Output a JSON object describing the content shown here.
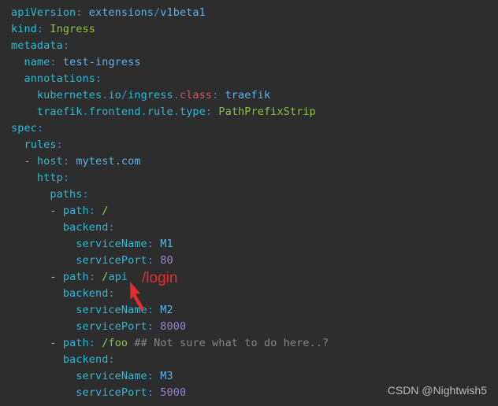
{
  "editor": {
    "background": "#2d2d2d",
    "language": "yaml",
    "filename_hint": "ingress.yaml",
    "lines": [
      {
        "indent": 0,
        "tokens": [
          {
            "text": "apiVersion",
            "type": "key"
          },
          {
            "text": ":",
            "type": "colon"
          },
          {
            "text": " ",
            "type": "plain"
          },
          {
            "text": "extensions",
            "type": "str"
          },
          {
            "text": "/",
            "type": "slash"
          },
          {
            "text": "v1beta1",
            "type": "str"
          }
        ]
      },
      {
        "indent": 0,
        "tokens": [
          {
            "text": "kind",
            "type": "key"
          },
          {
            "text": ":",
            "type": "colon"
          },
          {
            "text": " ",
            "type": "plain"
          },
          {
            "text": "Ingress",
            "type": "green"
          }
        ]
      },
      {
        "indent": 0,
        "tokens": [
          {
            "text": "metadata",
            "type": "key"
          },
          {
            "text": ":",
            "type": "colon"
          }
        ]
      },
      {
        "indent": 1,
        "tokens": [
          {
            "text": "name",
            "type": "key"
          },
          {
            "text": ":",
            "type": "colon"
          },
          {
            "text": " ",
            "type": "plain"
          },
          {
            "text": "test-ingress",
            "type": "str"
          }
        ]
      },
      {
        "indent": 1,
        "tokens": [
          {
            "text": "annotations",
            "type": "key"
          },
          {
            "text": ":",
            "type": "colon"
          }
        ]
      },
      {
        "indent": 2,
        "tokens": [
          {
            "text": "kubernetes",
            "type": "key"
          },
          {
            "text": ".",
            "type": "colon"
          },
          {
            "text": "io",
            "type": "key"
          },
          {
            "text": "/",
            "type": "slash"
          },
          {
            "text": "ingress",
            "type": "key"
          },
          {
            "text": ".",
            "type": "colon"
          },
          {
            "text": "class",
            "type": "kw"
          },
          {
            "text": ":",
            "type": "colon"
          },
          {
            "text": " ",
            "type": "plain"
          },
          {
            "text": "traefik",
            "type": "str"
          }
        ]
      },
      {
        "indent": 2,
        "tokens": [
          {
            "text": "traefik",
            "type": "key"
          },
          {
            "text": ".",
            "type": "colon"
          },
          {
            "text": "frontend",
            "type": "key"
          },
          {
            "text": ".",
            "type": "colon"
          },
          {
            "text": "rule",
            "type": "key"
          },
          {
            "text": ".",
            "type": "colon"
          },
          {
            "text": "type",
            "type": "key"
          },
          {
            "text": ":",
            "type": "colon"
          },
          {
            "text": " ",
            "type": "plain"
          },
          {
            "text": "PathPrefixStrip",
            "type": "green"
          }
        ]
      },
      {
        "indent": 0,
        "tokens": [
          {
            "text": "spec",
            "type": "key"
          },
          {
            "text": ":",
            "type": "colon"
          }
        ]
      },
      {
        "indent": 1,
        "tokens": [
          {
            "text": "rules",
            "type": "key"
          },
          {
            "text": ":",
            "type": "colon"
          }
        ]
      },
      {
        "indent": 1,
        "tokens": [
          {
            "text": "- ",
            "type": "dash"
          },
          {
            "text": "host",
            "type": "key"
          },
          {
            "text": ":",
            "type": "colon"
          },
          {
            "text": " ",
            "type": "plain"
          },
          {
            "text": "mytest.com",
            "type": "str"
          }
        ]
      },
      {
        "indent": 2,
        "tokens": [
          {
            "text": "http",
            "type": "key"
          },
          {
            "text": ":",
            "type": "colon"
          }
        ]
      },
      {
        "indent": 3,
        "tokens": [
          {
            "text": "paths",
            "type": "key"
          },
          {
            "text": ":",
            "type": "colon"
          }
        ]
      },
      {
        "indent": 3,
        "tokens": [
          {
            "text": "- ",
            "type": "dash"
          },
          {
            "text": "path",
            "type": "key"
          },
          {
            "text": ":",
            "type": "colon"
          },
          {
            "text": " ",
            "type": "plain"
          },
          {
            "text": "/",
            "type": "pathsep"
          }
        ]
      },
      {
        "indent": 4,
        "tokens": [
          {
            "text": "backend",
            "type": "key"
          },
          {
            "text": ":",
            "type": "colon"
          }
        ]
      },
      {
        "indent": 5,
        "tokens": [
          {
            "text": "serviceName",
            "type": "key"
          },
          {
            "text": ":",
            "type": "colon"
          },
          {
            "text": " ",
            "type": "plain"
          },
          {
            "text": "M1",
            "type": "str"
          }
        ]
      },
      {
        "indent": 5,
        "tokens": [
          {
            "text": "servicePort",
            "type": "key"
          },
          {
            "text": ":",
            "type": "colon"
          },
          {
            "text": " ",
            "type": "plain"
          },
          {
            "text": "80",
            "type": "num"
          }
        ]
      },
      {
        "indent": 3,
        "tokens": [
          {
            "text": "- ",
            "type": "dash"
          },
          {
            "text": "path",
            "type": "key"
          },
          {
            "text": ":",
            "type": "colon"
          },
          {
            "text": " ",
            "type": "plain"
          },
          {
            "text": "/",
            "type": "pathsep"
          },
          {
            "text": "api",
            "type": "key"
          }
        ]
      },
      {
        "indent": 4,
        "tokens": [
          {
            "text": "backend",
            "type": "key"
          },
          {
            "text": ":",
            "type": "colon"
          }
        ]
      },
      {
        "indent": 5,
        "tokens": [
          {
            "text": "serviceName",
            "type": "key"
          },
          {
            "text": ":",
            "type": "colon"
          },
          {
            "text": " ",
            "type": "plain"
          },
          {
            "text": "M2",
            "type": "str"
          }
        ]
      },
      {
        "indent": 5,
        "tokens": [
          {
            "text": "servicePort",
            "type": "key"
          },
          {
            "text": ":",
            "type": "colon"
          },
          {
            "text": " ",
            "type": "plain"
          },
          {
            "text": "8000",
            "type": "num"
          }
        ]
      },
      {
        "indent": 3,
        "tokens": [
          {
            "text": "- ",
            "type": "dash"
          },
          {
            "text": "path",
            "type": "key"
          },
          {
            "text": ":",
            "type": "colon"
          },
          {
            "text": " ",
            "type": "plain"
          },
          {
            "text": "/",
            "type": "pathsep"
          },
          {
            "text": "foo",
            "type": "green"
          },
          {
            "text": " ",
            "type": "plain"
          },
          {
            "text": "## Not sure what to do here..?",
            "type": "comment"
          }
        ]
      },
      {
        "indent": 4,
        "tokens": [
          {
            "text": "backend",
            "type": "key"
          },
          {
            "text": ":",
            "type": "colon"
          }
        ]
      },
      {
        "indent": 5,
        "tokens": [
          {
            "text": "serviceName",
            "type": "key"
          },
          {
            "text": ":",
            "type": "colon"
          },
          {
            "text": " ",
            "type": "plain"
          },
          {
            "text": "M3",
            "type": "str"
          }
        ]
      },
      {
        "indent": 5,
        "tokens": [
          {
            "text": "servicePort",
            "type": "key"
          },
          {
            "text": ":",
            "type": "colon"
          },
          {
            "text": " ",
            "type": "plain"
          },
          {
            "text": "5000",
            "type": "num"
          }
        ]
      }
    ]
  },
  "annotation": {
    "text": "/login",
    "color": "#e02f2f",
    "arrow_color": "#e02f2f"
  },
  "watermark": {
    "text": "CSDN @Nightwish5",
    "color": "#c7c7c7"
  }
}
